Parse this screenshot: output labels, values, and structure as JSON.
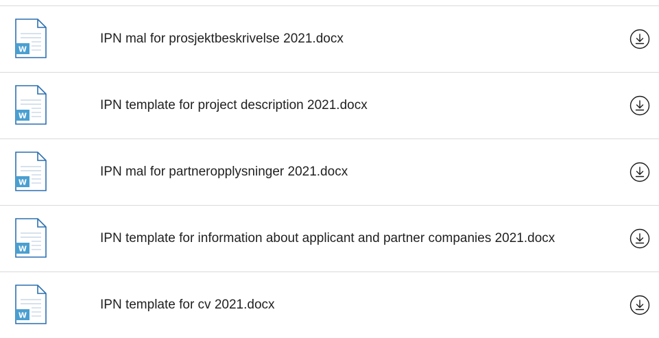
{
  "files": [
    {
      "name": "IPN mal for prosjektbeskrivelse 2021.docx",
      "badge": "W"
    },
    {
      "name": "IPN template for project description 2021.docx",
      "badge": "W"
    },
    {
      "name": "IPN mal for partneropplysninger 2021.docx",
      "badge": "W"
    },
    {
      "name": "IPN template for information about applicant and partner companies 2021.docx",
      "badge": "W"
    },
    {
      "name": "IPN template for cv 2021.docx",
      "badge": "W"
    }
  ],
  "icons": {
    "file": "word-document-icon",
    "download": "download-icon"
  },
  "colors": {
    "word_badge": "#4a9fd1",
    "icon_outline": "#2b6fb0",
    "download_stroke": "#1a1a1a",
    "divider": "#d9d9d9"
  }
}
